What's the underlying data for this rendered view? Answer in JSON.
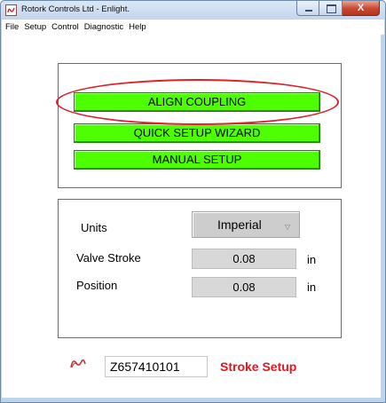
{
  "window": {
    "title": "Rotork Controls Ltd - Enlight.",
    "close_glyph": "X"
  },
  "menu": [
    "File",
    "Setup",
    "Control",
    "Diagnostic",
    "Help"
  ],
  "setup_buttons": {
    "align_coupling": "ALIGN COUPLING",
    "quick_setup_wizard": "QUICK SETUP WIZARD",
    "manual_setup": "MANUAL SETUP"
  },
  "settings": {
    "units_label": "Units",
    "units_value": "Imperial",
    "valve_stroke_label": "Valve Stroke",
    "valve_stroke_value": "0.08",
    "valve_stroke_unit": "in",
    "position_label": "Position",
    "position_value": "0.08",
    "position_unit": "in"
  },
  "footer": {
    "serial_number": "Z657410101",
    "mode_text": "Stroke Setup"
  },
  "colors": {
    "button_green": "#4dff00",
    "highlight_red": "#e0202a",
    "mode_text_red": "#e8141c",
    "title_bar": "#c3d6ec"
  },
  "icons": {
    "app": "rotork-app-icon",
    "logo": "rotork-logo-icon",
    "dropdown": "triangle-down-icon"
  }
}
